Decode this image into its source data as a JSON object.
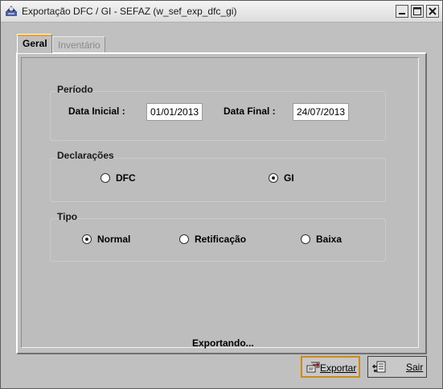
{
  "window": {
    "title": "Exportação DFC / GI - SEFAZ (w_sef_exp_dfc_gi)",
    "app_icon": "app-icon",
    "controls": [
      "minimize-icon",
      "maximize-icon",
      "close-icon"
    ]
  },
  "tabs": [
    {
      "label": "Geral",
      "active": true
    },
    {
      "label": "Inventário",
      "active": false
    }
  ],
  "periodo": {
    "group_label": "Período",
    "data_inicial_label": "Data Inicial  :",
    "data_inicial_value": "01/01/2013",
    "data_final_label": "Data Final :",
    "data_final_value": "24/07/2013"
  },
  "declaracoes": {
    "group_label": "Declarações",
    "options": [
      {
        "label": "DFC",
        "checked": false
      },
      {
        "label": "GI",
        "checked": true
      }
    ]
  },
  "tipo": {
    "group_label": "Tipo",
    "options": [
      {
        "label": "Normal",
        "checked": true
      },
      {
        "label": "Retificação",
        "checked": false
      },
      {
        "label": "Baixa",
        "checked": false
      }
    ]
  },
  "status": {
    "text": "Exportando..."
  },
  "buttons": {
    "exportar_label": "Exportar",
    "exportar_icon": "export-icon",
    "sair_label": "Sair",
    "sair_icon": "exit-icon"
  },
  "colors": {
    "background": "#c0c0c0",
    "focus_accent": "#d08a18"
  }
}
